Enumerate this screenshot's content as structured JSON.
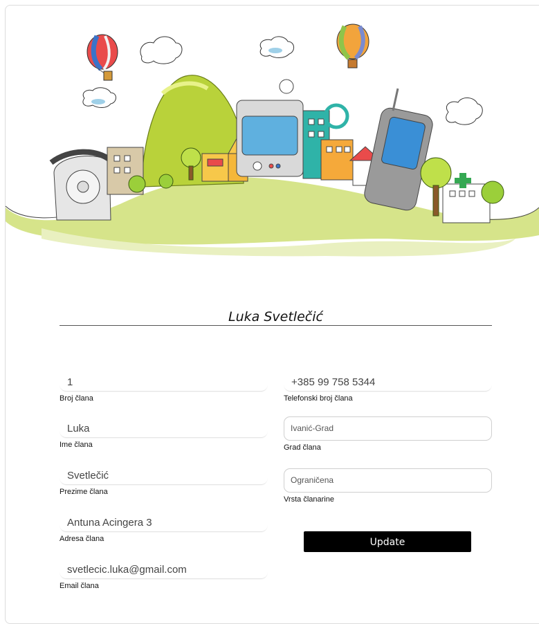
{
  "member": {
    "name": "Luka Svetlečić"
  },
  "fields_left": [
    {
      "value": "1",
      "label": "Broj člana"
    },
    {
      "value": "Luka",
      "label": "Ime člana"
    },
    {
      "value": "Svetlečić",
      "label": "Prezime člana"
    },
    {
      "value": "Antuna Acingera 3",
      "label": "Adresa člana"
    },
    {
      "value": "svetlecic.luka@gmail.com",
      "label": "Email člana"
    }
  ],
  "fields_right": [
    {
      "value": "+385 99 758 5344",
      "label": "Telefonski broj člana"
    },
    {
      "value": "Ivanić-Grad",
      "label": "Grad člana"
    },
    {
      "value": "Ograničena",
      "label": "Vrsta članarine"
    }
  ],
  "actions": {
    "update_label": "Update"
  },
  "colors": {
    "button_bg": "#000000",
    "button_text": "#ffffff",
    "hill_green": "#c5d94a"
  }
}
